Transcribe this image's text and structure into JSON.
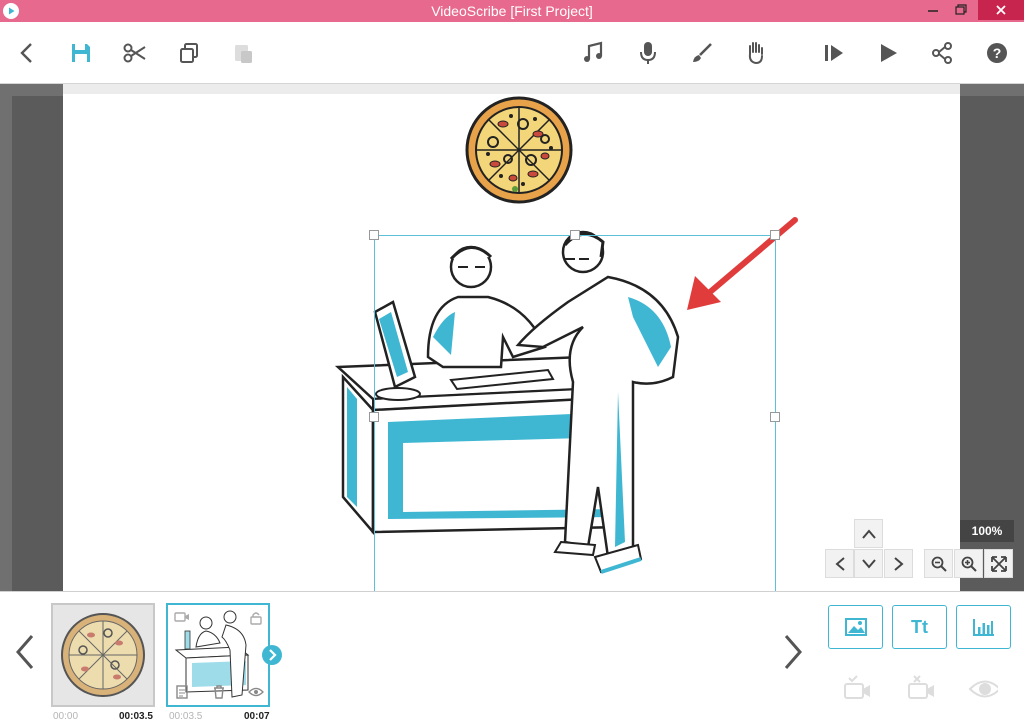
{
  "window": {
    "title": "VideoScribe [First Project]"
  },
  "toolbar": {
    "left": [
      "back-icon",
      "save-icon",
      "cut-icon",
      "copy-icon",
      "paste-icon"
    ],
    "right": [
      "music-icon",
      "microphone-icon",
      "brush-icon",
      "hand-icon",
      "play-from-icon",
      "play-icon",
      "share-icon",
      "help-icon"
    ]
  },
  "canvas": {
    "zoom_label": "100%"
  },
  "timeline": {
    "scenes": [
      {
        "start": "00:00",
        "duration": "00:03.5"
      },
      {
        "start": "00:03.5",
        "duration": "00:07"
      }
    ],
    "add_text_label": "Tt"
  },
  "colors": {
    "titlebar": "#e8698e",
    "accent": "#3fb7d3",
    "selection": "#5bc0d8",
    "arrow": "#e03c3c"
  }
}
